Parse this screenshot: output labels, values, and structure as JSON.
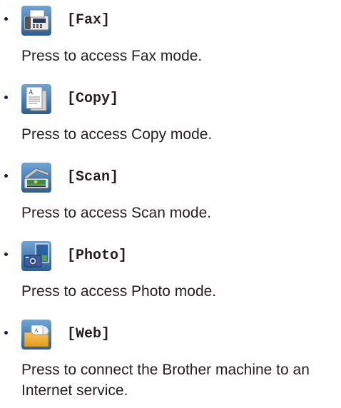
{
  "items": [
    {
      "label": "[Fax]",
      "icon": "fax-icon",
      "description": "Press to access Fax mode."
    },
    {
      "label": "[Copy]",
      "icon": "copy-icon",
      "description": "Press to access Copy mode."
    },
    {
      "label": "[Scan]",
      "icon": "scan-icon",
      "description": "Press to access Scan mode."
    },
    {
      "label": "[Photo]",
      "icon": "photo-icon",
      "description": "Press to access Photo mode."
    },
    {
      "label": "[Web]",
      "icon": "web-icon",
      "description": "Press to connect the Brother machine to an Internet service."
    }
  ],
  "colors": {
    "text": "#231f20",
    "icon_bg": "#4a7fb0"
  }
}
